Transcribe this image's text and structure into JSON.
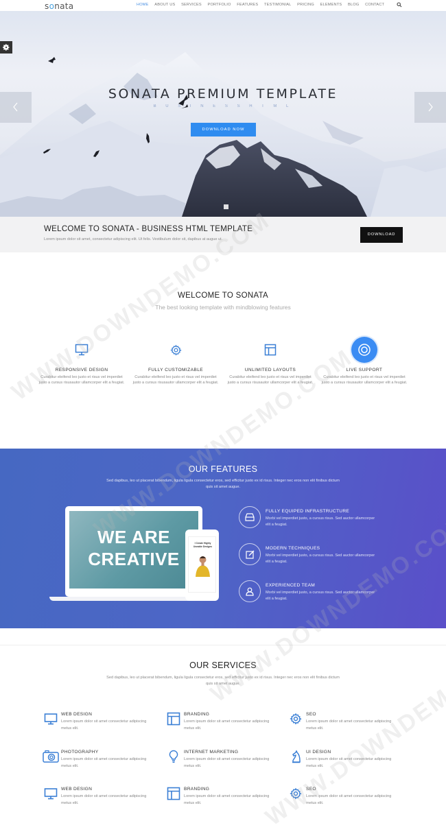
{
  "nav": {
    "logo_pre": "s",
    "logo_o": "o",
    "logo_post": "nata",
    "items": [
      "HOME",
      "ABOUT US",
      "SERVICES",
      "PORTFOLIO",
      "FEATURES",
      "TESTIMONIAL",
      "PRICING",
      "ELEMENTS",
      "BLOG",
      "CONTACT"
    ],
    "active": "HOME",
    "search_icon": "search-icon"
  },
  "hero": {
    "title": "SONATA PREMIUM TEMPLATE",
    "subtitle": "B U S I N E S S   H T M L",
    "button": "DOWNLOAD NOW",
    "prev_icon": "chevron-left-icon",
    "next_icon": "chevron-right-icon",
    "settings_icon": "gear-icon"
  },
  "banner": {
    "title": "WELCOME TO SONATA - BUSINESS HTML TEMPLATE",
    "text": "Lorem ipsum dolor sit amet, consectetur adipiscing elit. Ut felis. Vestibulum dolor sit, dapibus at augue ut.",
    "button": "DOWNLOAD"
  },
  "welcome": {
    "title": "WELCOME TO SONATA",
    "subtitle": "The best looking template with mindblowing features",
    "features": [
      {
        "icon": "monitor-icon",
        "title": "RESPONSIVE DESIGN",
        "text": "Curabitur eleifend leo justo et risus vel imperdiet justo a cursus risusautor ullamcorper elit a feugiat."
      },
      {
        "icon": "gear-icon",
        "title": "FULLY CUSTOMIZABLE",
        "text": "Curabitur eleifend leo justo et risus vel imperdiet justo a cursus risusautor ullamcorper elit a feugiat."
      },
      {
        "icon": "layout-icon",
        "title": "UNLIMITED LAYOUTS",
        "text": "Curabitur eleifend leo justo et risus vel imperdiet justo a cursus risusautor ullamcorper elit a feugiat."
      },
      {
        "icon": "lifebuoy-icon",
        "title": "LIVE SUPPORT",
        "text": "Curabitur eleifend leo justo et risus vel imperdiet justo a cursus risusautor ullamcorper elit a feugiat."
      }
    ]
  },
  "our_features": {
    "title": "OUR FEATURES",
    "subtitle": "Sed dapibus, leo ut placerat bibendum, ligula ligula consectetur eros, sed efficitur justo ex id risus. Integer nec eros non elit finibus dictum quis sit amet augue.",
    "screen_text": "WE ARE CREATIVE",
    "phone_text": "I Create Highly Useable Designs",
    "items": [
      {
        "icon": "hard-drive-icon",
        "title": "FULLY EQUIPED INFRASTRUCTURE",
        "text": "Morbi vel imperdiet justo, a cursus risus. Sed auctor ullamcorper elit a feugiat."
      },
      {
        "icon": "edit-icon",
        "title": "MODERN TECHNIQUES",
        "text": "Morbi vel imperdiet justo, a cursus risus. Sed auctor ullamcorper elit a feugiat."
      },
      {
        "icon": "user-icon",
        "title": "EXPERIENCED TEAM",
        "text": "Morbi vel imperdiet justo, a cursus risus. Sed auctor ullamcorper elit a feugiat."
      }
    ]
  },
  "services": {
    "title": "OUR SERVICES",
    "subtitle": "Sed dapibus, leo ut placerat bibendum, ligula ligula consectetur eros, sed efficitur justo ex id risus. Integer nec eros non elit finibus dictum quis sit amet augue.",
    "items": [
      {
        "icon": "monitor-icon",
        "title": "WEB DESIGN",
        "text": "Lorem ipsum dolor sit amet consectetur adipiscing metus elit."
      },
      {
        "icon": "layout-icon",
        "title": "BRANDING",
        "text": "Lorem ipsum dolor sit amet consectetur adipiscing metus elit."
      },
      {
        "icon": "gear-icon",
        "title": "SEO",
        "text": "Lorem ipsum dolor sit amet consectetur adipiscing metus elit."
      },
      {
        "icon": "camera-icon",
        "title": "PHOTOGRAPHY",
        "text": "Lorem ipsum dolor sit amet consectetur adipiscing metus elit."
      },
      {
        "icon": "lightbulb-icon",
        "title": "INTERNET MARKETING",
        "text": "Lorem ipsum dolor sit amet consectetur adipiscing metus elit."
      },
      {
        "icon": "chess-knight-icon",
        "title": "UI DESIGN",
        "text": "Lorem ipsum dolor sit amet consectetur adipiscing metus elit."
      },
      {
        "icon": "monitor-icon",
        "title": "WEB DESIGN",
        "text": "Lorem ipsum dolor sit amet consectetur adipiscing metus elit."
      },
      {
        "icon": "layout-icon",
        "title": "BRANDING",
        "text": "Lorem ipsum dolor sit amet consectetur adipiscing metus elit."
      },
      {
        "icon": "gear-icon",
        "title": "SEO",
        "text": "Lorem ipsum dolor sit amet consectetur adipiscing metus elit."
      }
    ]
  },
  "watermark": "WWW.DOWNDEMO.COM",
  "colors": {
    "accent": "#2f8cf0",
    "features_bg_start": "#4668c2",
    "features_bg_end": "#5a4fc9",
    "icon_blue": "#3a7fd5"
  }
}
